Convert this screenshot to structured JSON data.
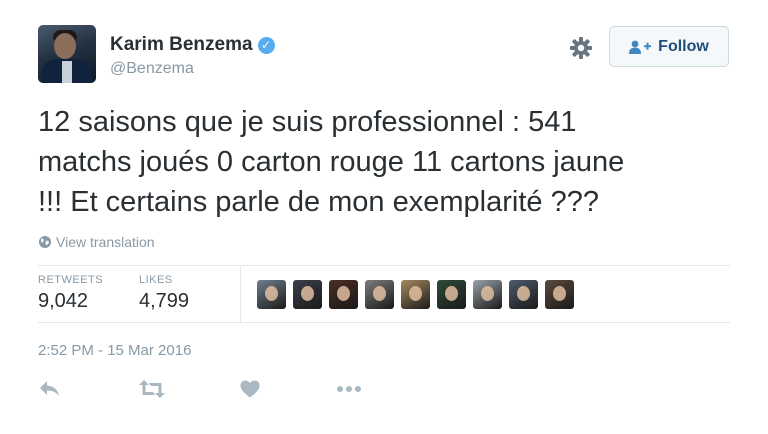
{
  "author": {
    "name": "Karim Benzema",
    "handle": "@Benzema",
    "verified_mark": "✓"
  },
  "header": {
    "follow_label": "Follow"
  },
  "tweet": {
    "lines": [
      "12 saisons que je suis professionnel : 541",
      "matchs joués 0 carton rouge 11 cartons jaune",
      "!!! Et certains parle de mon exemplarité ???"
    ],
    "translate_label": "View translation"
  },
  "stats": {
    "retweets_label": "RETWEETS",
    "retweets_value": "9,042",
    "likes_label": "LIKES",
    "likes_value": "4,799"
  },
  "likers": [
    {
      "color": "#6f7f8c"
    },
    {
      "color": "#3b3f4a"
    },
    {
      "color": "#4a2e22"
    },
    {
      "color": "#7c7c7c"
    },
    {
      "color": "#a98a5e"
    },
    {
      "color": "#2f4a3a"
    },
    {
      "color": "#9aa2a8"
    },
    {
      "color": "#4d5a6b"
    },
    {
      "color": "#5b4a3e"
    }
  ],
  "timestamp": "2:52 PM - 15 Mar 2016",
  "icons": {
    "reply": "reply-icon",
    "retweet": "retweet-icon",
    "like": "heart-icon",
    "more": "more-icon"
  },
  "colors": {
    "accent": "#55acee",
    "text": "#292f33",
    "muted": "#8899a6",
    "action_icon": "#aab8c2"
  }
}
